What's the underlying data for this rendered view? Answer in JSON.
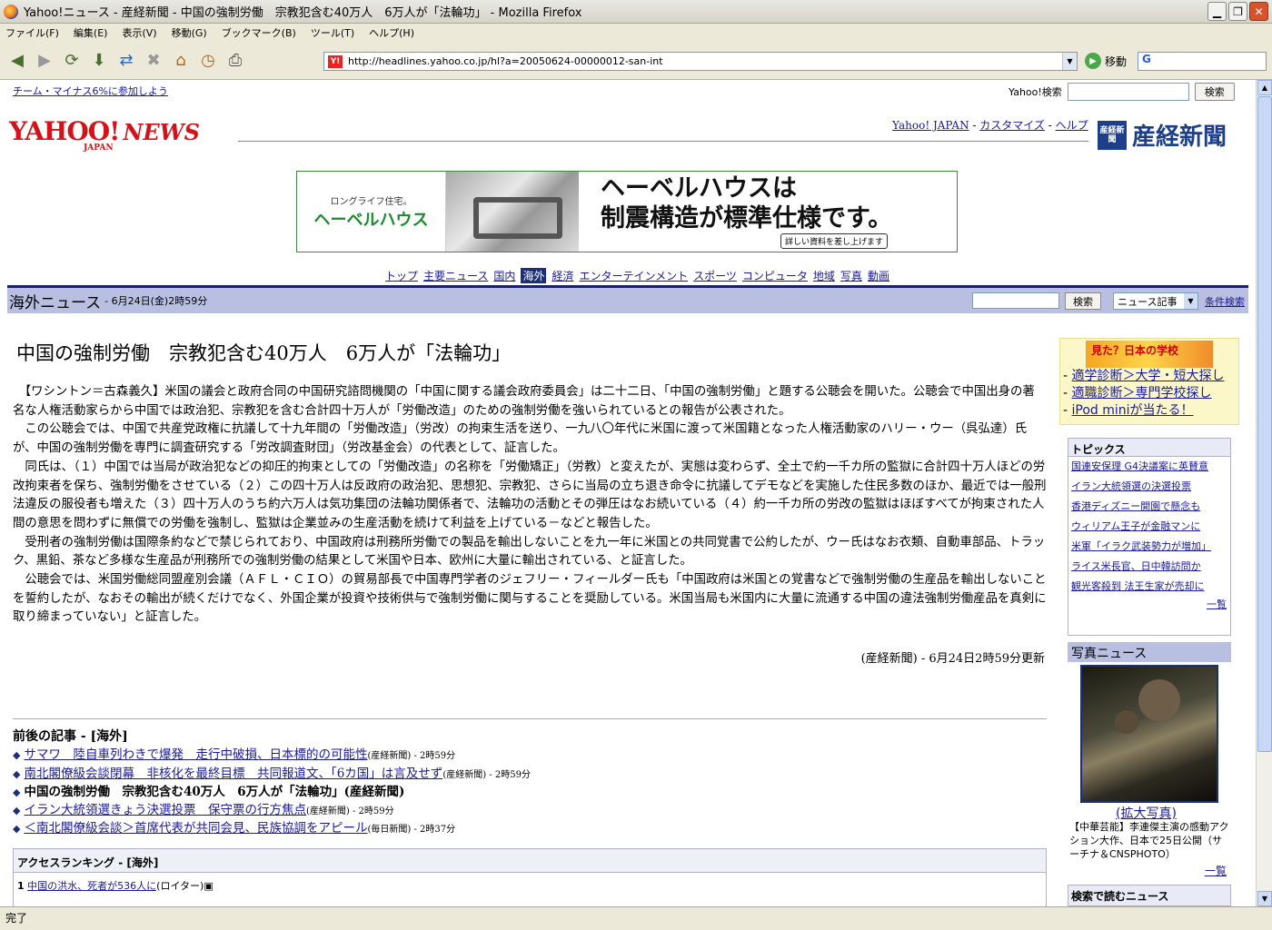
{
  "window": {
    "title": "Yahoo!ニュース - 産経新聞 - 中国の強制労働　宗教犯含む40万人　6万人が「法輪功」 - Mozilla Firefox"
  },
  "menu": [
    "ファイル(F)",
    "編集(E)",
    "表示(V)",
    "移動(G)",
    "ブックマーク(B)",
    "ツール(T)",
    "ヘルプ(H)"
  ],
  "url": "http://headlines.yahoo.co.jp/hl?a=20050624-00000012-san-int",
  "go_label": "移動",
  "status": "完了",
  "page": {
    "top_link": "チーム・マイナス6%に参加しよう",
    "search_label": "Yahoo!検索",
    "search_button": "検索",
    "logo_yahoo": "YAHOO!",
    "logo_news": "NEWS",
    "logo_japan": "JAPAN",
    "header_links": [
      "Yahoo! JAPAN",
      "カスタマイズ",
      "ヘルプ"
    ],
    "sankei_seal": "産経新聞",
    "sankei_name": "産経新聞",
    "banner": {
      "small": "ロングライフ住宅。",
      "brand": "ヘーベルハウス",
      "line1": "ヘーベルハウスは",
      "line2": "制震構造が標準仕様です。",
      "cta": "詳しい資料を差し上げます"
    },
    "categories": [
      "トップ",
      "主要ニュース",
      "国内",
      "海外",
      "経済",
      "エンターテインメント",
      "スポーツ",
      "コンピュータ",
      "地域",
      "写真",
      "動画"
    ],
    "section_title": "海外ニュース",
    "section_date": "- 6月24日(金)2時59分",
    "section_search_button": "検索",
    "section_select": "ニュース記事",
    "section_adv": "条件検索",
    "headline": "中国の強制労働　宗教犯含む40万人　6万人が「法輪功」",
    "body": "　【ワシントン＝古森義久】米国の議会と政府合同の中国研究諮問機関の「中国に関する議会政府委員会」は二十二日、「中国の強制労働」と題する公聴会を開いた。公聴会で中国出身の著名な人権活動家らから中国では政治犯、宗教犯を含む合計四十万人が「労働改造」のための強制労働を強いられているとの報告が公表された。\n　この公聴会では、中国で共産党政権に抗議して十九年間の「労働改造」（労改）の拘束生活を送り、一九八〇年代に米国に渡って米国籍となった人権活動家のハリー・ウー（呉弘達）氏が、中国の強制労働を専門に調査研究する「労改調査財団」（労改基金会）の代表として、証言した。\n　同氏は、（１）中国では当局が政治犯などの抑圧的拘束としての「労働改造」の名称を「労働矯正」（労教）と変えたが、実態は変わらず、全土で約一千カ所の監獄に合計四十万人ほどの労改拘束者を保ち、強制労働をさせている（２）この四十万人は反政府の政治犯、思想犯、宗教犯、さらに当局の立ち退き命令に抗議してデモなどを実施した住民多数のほか、最近では一般刑法違反の服役者も増えた（３）四十万人のうち約六万人は気功集団の法輪功関係者で、法輪功の活動とその弾圧はなお続いている（４）約一千カ所の労改の監獄はほぼすべてが拘束された人間の意思を問わずに無償での労働を強制し、監獄は企業並みの生産活動を続けて利益を上げている－などと報告した。\n　受刑者の強制労働は国際条約などで禁じられており、中国政府は刑務所労働での製品を輸出しないことを九一年に米国との共同覚書で公約したが、ウー氏はなお衣類、自動車部品、トラック、黒鉛、茶など多様な生産品が刑務所での強制労働の結果として米国や日本、欧州に大量に輸出されている、と証言した。\n　公聴会では、米国労働総同盟産別会議（ＡＦＬ・ＣＩＯ）の貿易部長で中国専門学者のジェフリー・フィールダー氏も「中国政府は米国との覚書などで強制労働の生産品を輸出しないことを誓約したが、なおその輸出が続くだけでなく、外国企業が投資や技術供与で強制労働に関与することを奨励している。米国当局も米国内に大量に流通する中国の違法強制労働産品を真剣に取り締まっていない」と証言した。",
    "credit": "(産経新聞) - 6月24日2時59分更新",
    "related_title": "前後の記事 - [海外]",
    "related": [
      {
        "text": "サマワ　陸自車列わきで爆発　走行中破損、日本標的の可能性",
        "src": "(産経新聞) - 2時59分",
        "current": false
      },
      {
        "text": "南北閣僚級会談閉幕　非核化を最終目標　共同報道文、「6カ国」は言及せず",
        "src": "(産経新聞) - 2時59分",
        "current": false
      },
      {
        "text": "中国の強制労働　宗教犯含む40万人　6万人が「法輪功」(産経新聞)",
        "src": "",
        "current": true
      },
      {
        "text": "イラン大統領選きょう決選投票　保守票の行方焦点",
        "src": "(産経新聞) - 2時59分",
        "current": false
      },
      {
        "text": "＜南北閣僚級会談＞首席代表が共同会見、民族協調をアピール",
        "src": "(毎日新聞) - 2時37分",
        "current": false
      }
    ],
    "ranking_title": "アクセスランキング - [海外]",
    "ranking_first": {
      "num": "1",
      "text": "中国の洪水、死者が536人に",
      "src": "(ロイター)"
    },
    "side_ad": {
      "banner": "見た？日本の学校",
      "items": [
        "適学診断＞大学・短大探し",
        "適職診断＞専門学校探し",
        "iPod miniが当たる！"
      ]
    },
    "topics_title": "トピックス",
    "topics": [
      "国連安保理 G4決議案に英賛意",
      "イラン大統領選の決選投票",
      "香港ディズニー開園で懸念も",
      "ウィリアム王子が金融マンに",
      "米軍「イラク武装勢力が増加」",
      "ライス米長官、日中韓訪問か",
      "観光客殺到 法王生家が売却に"
    ],
    "topics_more": "一覧",
    "photo_title": "写真ニュース",
    "photo_link": "(拡大写真)",
    "photo_caption": "【中華芸能】李連傑主演の感動アクション大作、日本で25日公開（サーチナ＆CNSPHOTO）",
    "photo_more": "一覧",
    "search_news": "検索で読むニュース"
  }
}
